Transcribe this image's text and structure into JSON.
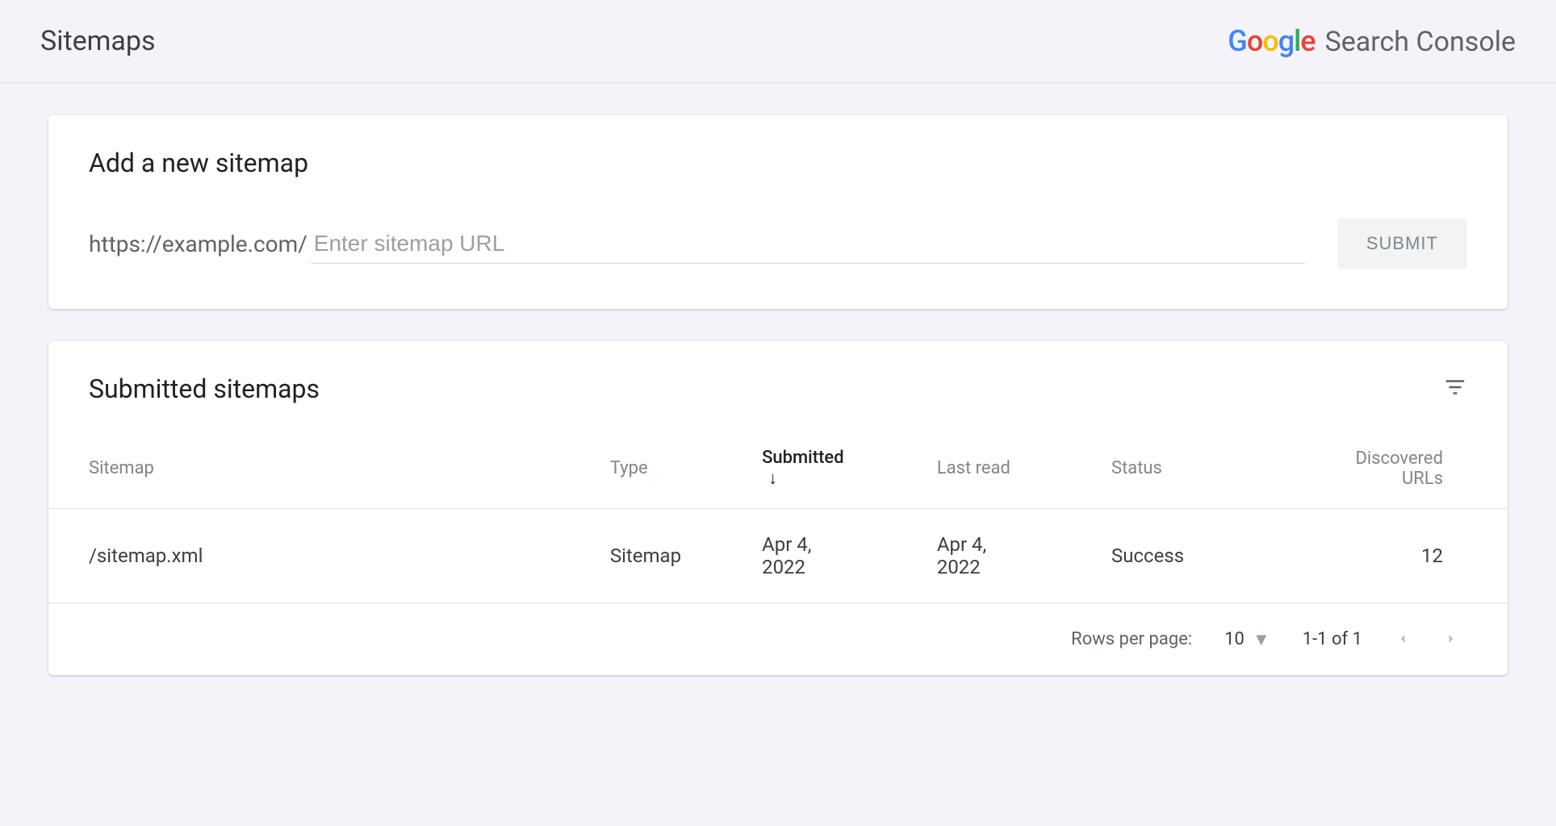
{
  "header": {
    "title": "Sitemaps",
    "brand": {
      "logo_letters": [
        "G",
        "o",
        "o",
        "g",
        "l",
        "e"
      ],
      "suffix": "Search Console"
    }
  },
  "add_card": {
    "title": "Add a new sitemap",
    "url_prefix": "https://example.com/",
    "input_placeholder": "Enter sitemap URL",
    "submit_label": "SUBMIT"
  },
  "submitted_card": {
    "title": "Submitted sitemaps",
    "columns": {
      "sitemap": "Sitemap",
      "type": "Type",
      "submitted": "Submitted",
      "last_read": "Last read",
      "status": "Status",
      "discovered": "Discovered URLs"
    },
    "sorted_column": "submitted",
    "sort_direction": "desc",
    "rows": [
      {
        "sitemap": "/sitemap.xml",
        "type": "Sitemap",
        "submitted": "Apr 4, 2022",
        "last_read": "Apr 4, 2022",
        "status": "Success",
        "status_color": "#188038",
        "discovered": "12"
      }
    ],
    "pager": {
      "rows_label": "Rows per page:",
      "rows_value": "10",
      "range": "1-1 of 1"
    }
  }
}
